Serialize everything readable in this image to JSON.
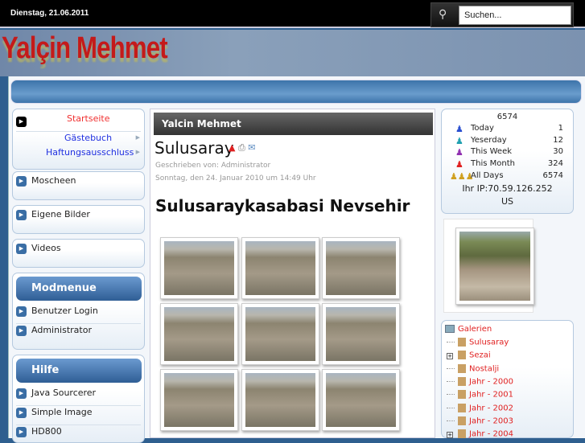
{
  "topbar": {
    "date": "Dienstag, 21.06.2011",
    "search_placeholder": "Suchen..."
  },
  "banner": {
    "logo": "Yalçin Mehmet"
  },
  "mainmenu": {
    "items": [
      {
        "label": "Startseite"
      },
      {
        "label": "Gästebuch"
      },
      {
        "label": "Haftungsausschluss"
      }
    ]
  },
  "menus": [
    {
      "label": "Moscheen"
    },
    {
      "label": "Eigene Bilder"
    },
    {
      "label": "Videos"
    }
  ],
  "modmenu": {
    "title": "Modmenue",
    "items": [
      "Benutzer Login",
      "Administrator"
    ]
  },
  "hilfe": {
    "title": "Hilfe",
    "items": [
      "Java Sourcerer",
      "Simple Image",
      "HD800"
    ]
  },
  "article": {
    "section": "Yalcin Mehmet",
    "title": "Sulusaray",
    "author": "Geschrieben von: Administrator",
    "date": "Sonntag, den 24. Januar 2010 um 14:49 Uhr",
    "heading": "Sulusaraykasabasi  Nevsehir",
    "photos": 9
  },
  "counter": {
    "total": "6574",
    "rows": [
      {
        "label": "Today",
        "value": "1",
        "color": "#2a4fd0"
      },
      {
        "label": "Yeserday",
        "value": "12",
        "color": "#20a0b0"
      },
      {
        "label": "This Week",
        "value": "30",
        "color": "#9030b0"
      },
      {
        "label": "This Month",
        "value": "324",
        "color": "#e02020"
      },
      {
        "label": "All Days",
        "value": "6574",
        "color": "#d0a020"
      }
    ],
    "ip": "Ihr IP:70.59.126.252",
    "country": "US"
  },
  "gallery": {
    "root": "Galerien",
    "items": [
      {
        "label": "Sulusaray",
        "expandable": false
      },
      {
        "label": "Sezai",
        "expandable": true
      },
      {
        "label": "Nostalji",
        "expandable": false
      },
      {
        "label": "Jahr - 2000",
        "expandable": false
      },
      {
        "label": "Jahr - 2001",
        "expandable": false
      },
      {
        "label": "Jahr - 2002",
        "expandable": false
      },
      {
        "label": "Jahr - 2003",
        "expandable": false
      },
      {
        "label": "Jahr - 2004",
        "expandable": true
      }
    ]
  }
}
